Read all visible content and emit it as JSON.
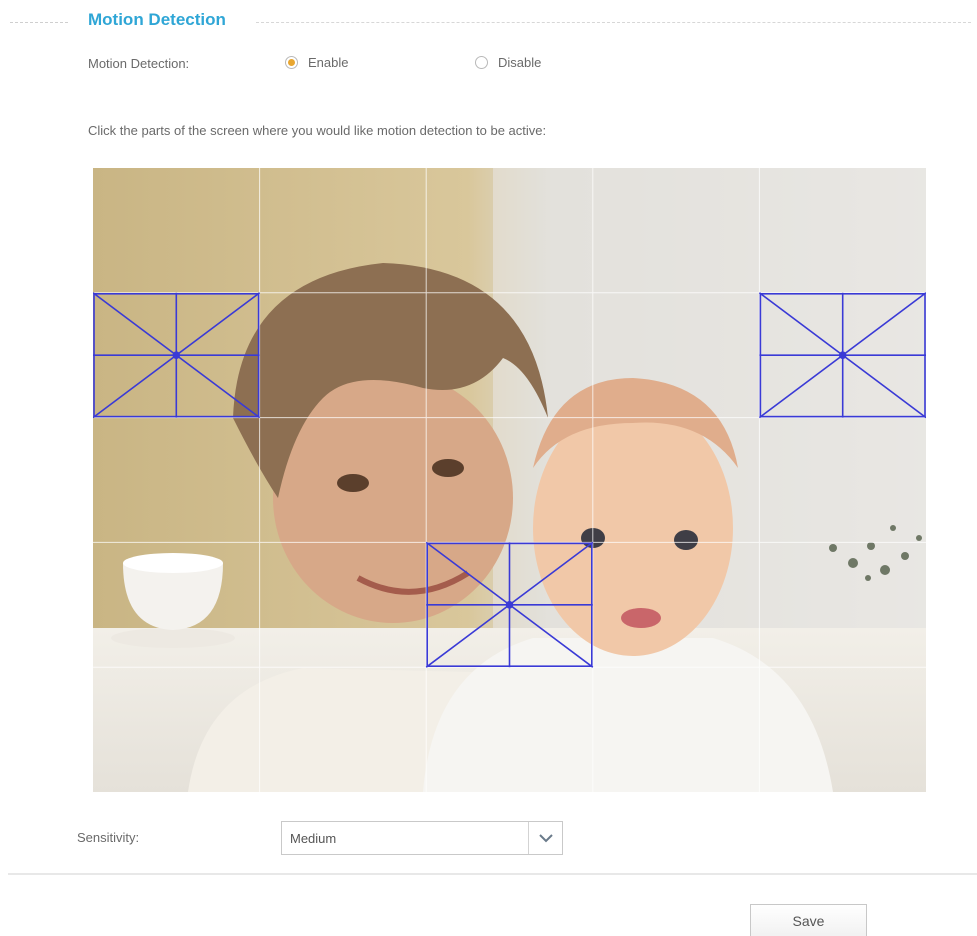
{
  "section": {
    "title": "Motion Detection"
  },
  "motion_detection": {
    "label": "Motion Detection:",
    "options": [
      {
        "label": "Enable",
        "checked": true
      },
      {
        "label": "Disable",
        "checked": false
      }
    ]
  },
  "instructions": "Click the parts of the screen where you would like motion detection to be active:",
  "detection_grid": {
    "columns": 5,
    "rows": 5,
    "active_cells": [
      [
        1,
        0
      ],
      [
        1,
        4
      ],
      [
        3,
        2
      ]
    ],
    "marker_color": "#3a3ad6"
  },
  "sensitivity": {
    "label": "Sensitivity:",
    "selected": "Medium"
  },
  "actions": {
    "save_label": "Save"
  },
  "colors": {
    "accent": "#2fa6d6",
    "radio_selected": "#e8a630"
  },
  "icons": {
    "dropdown": "chevron-down-icon"
  }
}
